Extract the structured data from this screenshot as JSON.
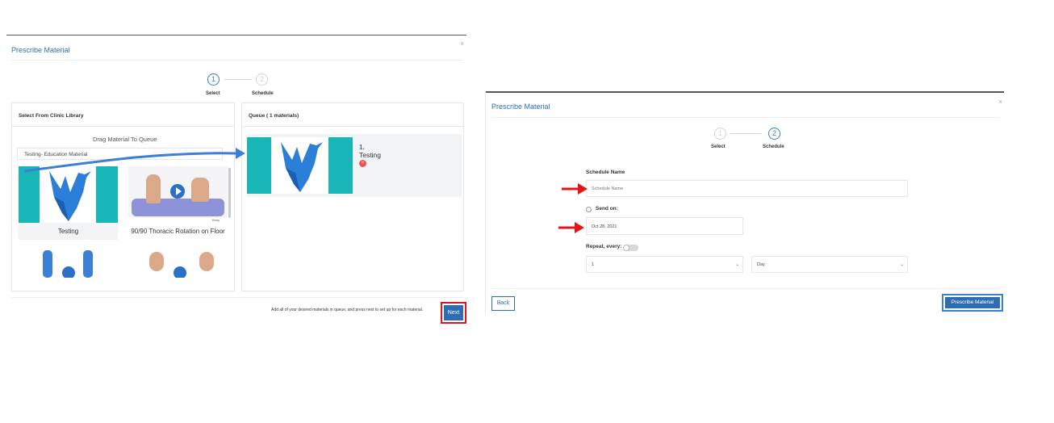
{
  "left": {
    "title": "Prescribe Material",
    "close": "×",
    "steps": [
      {
        "num": "1",
        "label": "Select"
      },
      {
        "num": "2",
        "label": "Schedule"
      }
    ],
    "library": {
      "header": "Select From Clinic Library",
      "drag_hint": "Drag Material To Queue",
      "filter_value": "Testing- Education Material",
      "items": [
        {
          "title": "Testing"
        },
        {
          "title": "90/90 Thoracic Rotation on Floor",
          "watermark": "Body"
        }
      ]
    },
    "queue": {
      "header": "Queue ( 1 materials)",
      "item_number": "1.",
      "item_title": "Testing"
    },
    "footer_hint": "Add all of your desired materials in queue, and press next to set up for each material.",
    "next_label": "Next"
  },
  "right": {
    "title": "Prescribe Material",
    "close": "×",
    "steps": [
      {
        "num": "1",
        "label": "Select"
      },
      {
        "num": "2",
        "label": "Schedule"
      }
    ],
    "schedule_name_label": "Schedule Name",
    "schedule_name_placeholder": "Schedule Name",
    "send_on_label": "Send on:",
    "send_on_value": "Oct 28, 2021",
    "repeat_label": "Repeat, every:",
    "repeat_count": "1",
    "repeat_unit": "Day",
    "back_label": "Back",
    "prescribe_label": "Prescribe Material"
  },
  "colors": {
    "accent": "#2f6db3",
    "teal": "#19b6b8",
    "annotation_red": "#e3141b",
    "arrow_blue": "#3b7fd6"
  }
}
